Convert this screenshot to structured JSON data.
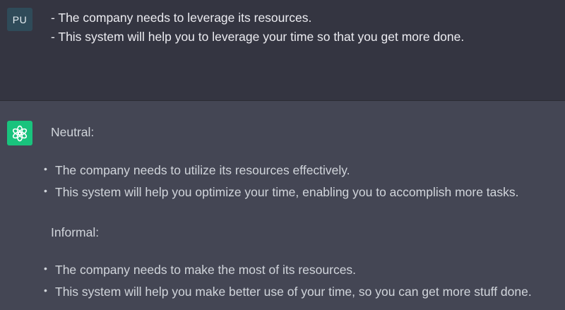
{
  "user_message": {
    "avatar_initials": "PU",
    "lines": [
      "- The company needs to leverage its resources.",
      "- This system will help you to leverage your time so that you get more done."
    ]
  },
  "assistant_message": {
    "avatar_icon": "openai-logo-icon",
    "sections": [
      {
        "heading": "Neutral:",
        "bullets": [
          "The company needs to utilize its resources effectively.",
          "This system will help you optimize your time, enabling you to accomplish more tasks."
        ]
      },
      {
        "heading": "Informal:",
        "bullets": [
          "The company needs to make the most of its resources.",
          "This system will help you make better use of your time, so you can get more stuff done."
        ]
      }
    ]
  },
  "colors": {
    "user_bg": "#343541",
    "assistant_bg": "#444654",
    "user_avatar_bg": "#2f4b59",
    "bot_avatar_bg": "#19c37d"
  }
}
